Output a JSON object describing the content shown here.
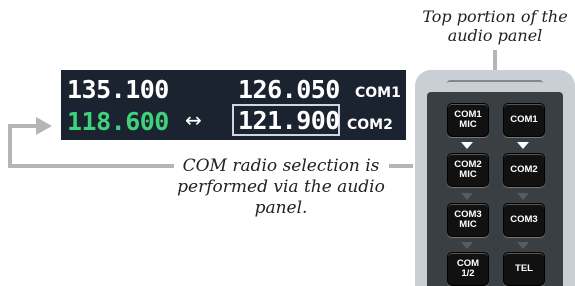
{
  "callouts": {
    "top_caption": "Top portion of the audio panel",
    "mid_caption": "COM radio selection is performed via the audio panel."
  },
  "com_display": {
    "com1": {
      "active": "135.100",
      "standby": "126.050",
      "label": "COM1"
    },
    "com2": {
      "active": "118.600",
      "standby": "121.900",
      "label": "COM2"
    },
    "transfer_symbol": "↔"
  },
  "audio_panel": {
    "buttons": [
      {
        "label": "COM1\nMIC",
        "led": "none"
      },
      {
        "label": "COM1",
        "led": "none"
      },
      {
        "label": "COM2\nMIC",
        "led": "on"
      },
      {
        "label": "COM2",
        "led": "on"
      },
      {
        "label": "COM3\nMIC",
        "led": "off"
      },
      {
        "label": "COM3",
        "led": "off"
      },
      {
        "label": "COM\n1/2",
        "led": "off"
      },
      {
        "label": "TEL",
        "led": "off"
      }
    ]
  },
  "colors": {
    "active_frequency": "#3ed27a",
    "display_background": "#1b2230",
    "callout_line": "#b5b5b5",
    "panel_bezel": "#c9cfd5"
  }
}
